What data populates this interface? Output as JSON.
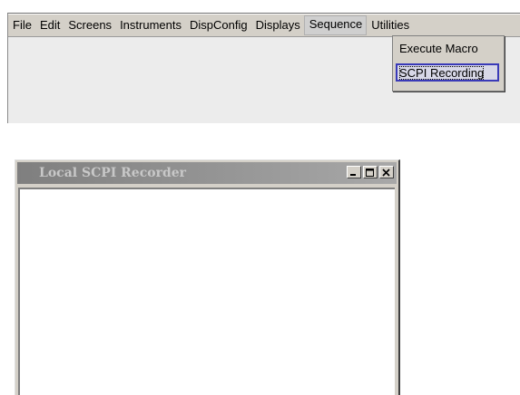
{
  "menubar": {
    "items": [
      "File",
      "Edit",
      "Screens",
      "Instruments",
      "DispConfig",
      "Displays",
      "Sequence",
      "Utilities"
    ],
    "active_item": "Sequence"
  },
  "sequence_menu": {
    "items": [
      "Execute Macro",
      "SCPI Recording"
    ],
    "highlighted": "SCPI Recording"
  },
  "recorder_window": {
    "title": "Local SCPI Recorder",
    "buttons": [
      "minimize-icon",
      "maximize-icon",
      "close-icon"
    ]
  },
  "colors": {
    "menu_background": "#d4d0c8",
    "highlight_border": "#3a3ab8",
    "inactive_titlebar": "#8f8f8f",
    "title_text": "#c8c8c8"
  }
}
